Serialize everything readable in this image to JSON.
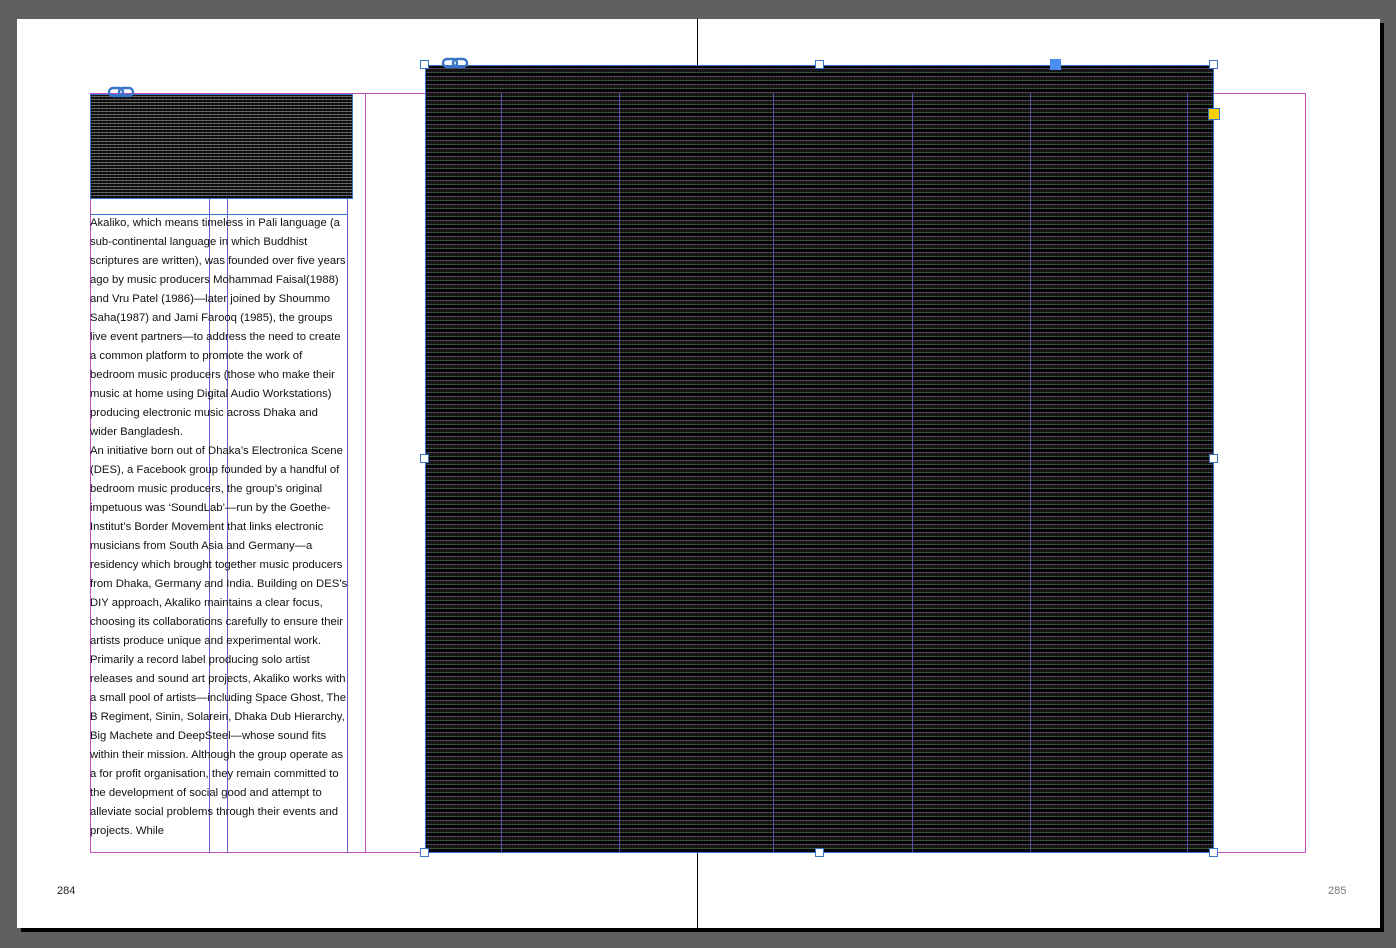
{
  "pages": {
    "left_number": "284",
    "right_number": "285"
  },
  "body_text": {
    "paragraphs": [
      "Akaliko, which means timeless in Pali language (a sub-continental language in which Buddhist scriptures are written), was founded over five years ago by music producers Mohammad Faisal(1988) and Vru Patel (1986)—later joined by Shoummo Saha(1987) and Jami Farooq (1985), the groups live event partners—to address the need to create a common platform to promote the work of bedroom music producers (those who make their music at home using Digital Audio Workstations) producing electronic music across Dhaka and wider Bangladesh.",
      "An initiative born out of Dhaka’s Electronica Scene (DES), a Facebook group founded by a handful of bedroom music producers, the group’s original impetuous was ‘SoundLab’—run by the Goethe-Institut’s Border Movement that links electronic musicians from South Asia and Germany—a residency which brought together music producers from Dhaka, Germany and India.  Building on DES’s DIY approach, Akaliko maintains a clear focus, choosing its collaborations carefully to ensure their artists produce unique and experimental work.",
      "Primarily a record label producing solo artist releases and sound art projects, Akaliko works with a small pool of artists—including Space Ghost, The B Regiment, Sinin, Solarein, Dhaka Dub Hierarchy, Big Machete and DeepSteel—whose sound fits within their mission.  Although the group operate as a for profit organisation, they remain committed to the development of social good and attempt to alleviate social problems through their events and projects.  While"
    ]
  },
  "icons": {
    "link_small_image": "link-icon",
    "link_large_image": "link-icon",
    "selection_corner": "selection-square",
    "adjust_handle": "live-corner-handle"
  },
  "colors": {
    "pasteboard": "#606060",
    "page": "#ffffff",
    "margin_guide": "#c44fc4",
    "column_guide": "#6a5acd",
    "frame_selection": "#3a74c8",
    "live_corner": "#f6d000"
  }
}
